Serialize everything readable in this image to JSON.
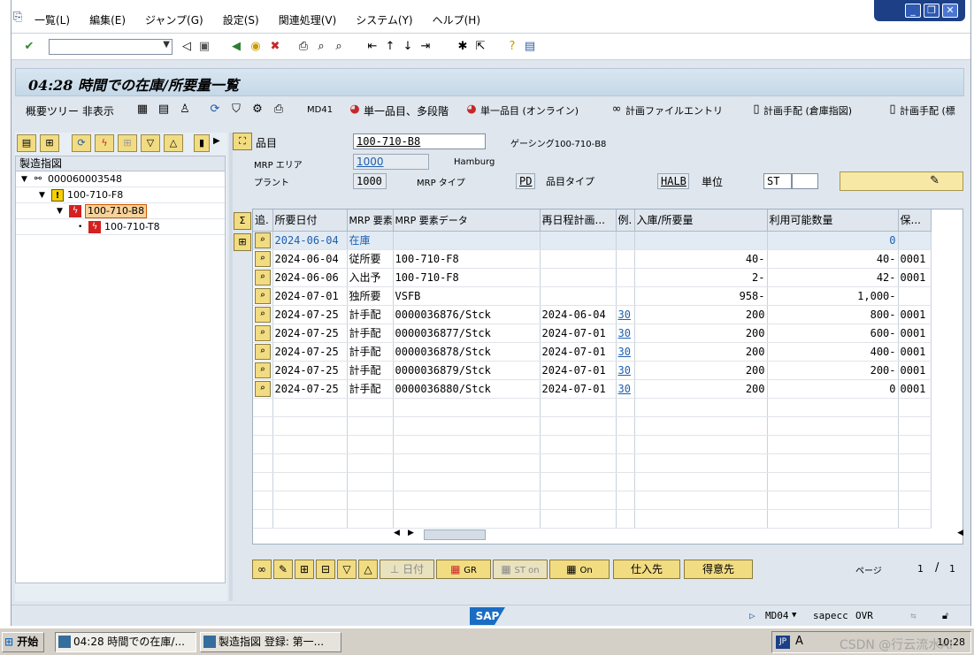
{
  "menu": [
    "一覧(L)",
    "編集(E)",
    "ジャンプ(G)",
    "設定(S)",
    "関連処理(V)",
    "システム(Y)",
    "ヘルプ(H)"
  ],
  "window_controls": {
    "min": "_",
    "restore": "❐",
    "close": "✕"
  },
  "command_field": {
    "value": ""
  },
  "title": "04:28 時間での在庫/所要量一覧",
  "app_toolbar": {
    "hide_tree": "概要ツリー 非表示",
    "md41": "MD41",
    "single_multi": "単一品目、多段階",
    "single_online": "単一品目 (オンライン)",
    "planning_file": "計画ファイルエントリ",
    "plan_order_wh": "計画手配 (倉庫指図)",
    "plan_order_std": "計画手配 (標"
  },
  "tree": {
    "header": "製造指図",
    "nodes": [
      {
        "label": "000060003548",
        "level": 0,
        "icon": "order-icon"
      },
      {
        "label": "100-710-F8",
        "level": 1,
        "icon": "warning-icon"
      },
      {
        "label": "100-710-B8",
        "level": 2,
        "icon": "exception-icon",
        "selected": true
      },
      {
        "label": "100-710-T8",
        "level": 3,
        "icon": "exception-icon"
      }
    ]
  },
  "header": {
    "material_label": "品目",
    "material": "100-710-B8",
    "material_desc": "ゲーシング100-710-B8",
    "mrp_area_label": "MRP エリア",
    "mrp_area": "1000",
    "mrp_area_name": "Hamburg",
    "plant_label": "プラント",
    "plant": "1000",
    "mrp_type_label": "MRP タイプ",
    "mrp_type": "PD",
    "material_type_label": "品目タイプ",
    "material_type": "HALB",
    "unit_label": "単位",
    "unit": "ST"
  },
  "grid": {
    "columns": [
      "追.",
      "所要日付",
      "MRP 要素",
      "MRP 要素データ",
      "再日程計画...",
      "例.",
      "入庫/所要量",
      "利用可能数量",
      "保..."
    ],
    "rows": [
      {
        "date": "2024-06-04",
        "element": "在庫",
        "data": "",
        "resched": "",
        "exc": "",
        "qty": "",
        "avail": "0",
        "sloc": "",
        "highlight": true
      },
      {
        "date": "2024-06-04",
        "element": "従所要",
        "data": "100-710-F8",
        "resched": "",
        "exc": "",
        "qty": "40-",
        "avail": "40-",
        "sloc": "0001"
      },
      {
        "date": "2024-06-06",
        "element": "入出予",
        "data": "100-710-F8",
        "resched": "",
        "exc": "",
        "qty": "2-",
        "avail": "42-",
        "sloc": "0001"
      },
      {
        "date": "2024-07-01",
        "element": "独所要",
        "data": "VSFB",
        "resched": "",
        "exc": "",
        "qty": "958-",
        "avail": "1,000-",
        "sloc": ""
      },
      {
        "date": "2024-07-25",
        "element": "計手配",
        "data": "0000036876/Stck",
        "resched": "2024-06-04",
        "exc": "30",
        "qty": "200",
        "avail": "800-",
        "sloc": "0001"
      },
      {
        "date": "2024-07-25",
        "element": "計手配",
        "data": "0000036877/Stck",
        "resched": "2024-07-01",
        "exc": "30",
        "qty": "200",
        "avail": "600-",
        "sloc": "0001"
      },
      {
        "date": "2024-07-25",
        "element": "計手配",
        "data": "0000036878/Stck",
        "resched": "2024-07-01",
        "exc": "30",
        "qty": "200",
        "avail": "400-",
        "sloc": "0001"
      },
      {
        "date": "2024-07-25",
        "element": "計手配",
        "data": "0000036879/Stck",
        "resched": "2024-07-01",
        "exc": "30",
        "qty": "200",
        "avail": "200-",
        "sloc": "0001"
      },
      {
        "date": "2024-07-25",
        "element": "計手配",
        "data": "0000036880/Stck",
        "resched": "2024-07-01",
        "exc": "30",
        "qty": "200",
        "avail": "0",
        "sloc": "0001"
      }
    ],
    "empty_rows": 7
  },
  "bottom_buttons": {
    "date": "日付",
    "gr": "GR",
    "st_on": "ST on",
    "on": "On",
    "vendor": "仕入先",
    "customer": "得意先"
  },
  "pager": {
    "label": "ページ",
    "current": "1",
    "sep": "/",
    "total": "1"
  },
  "status": {
    "logo": "SAP",
    "tcode": "MD04",
    "server": "sapecc",
    "mode": "OVR"
  },
  "taskbar": {
    "start": "开始",
    "tasks": [
      "04:28 時間での在庫/...",
      "製造指図 登録: 第一..."
    ],
    "ime": "JP",
    "clock": "10:28",
    "watermark": "CSDN @行云流水AI"
  }
}
